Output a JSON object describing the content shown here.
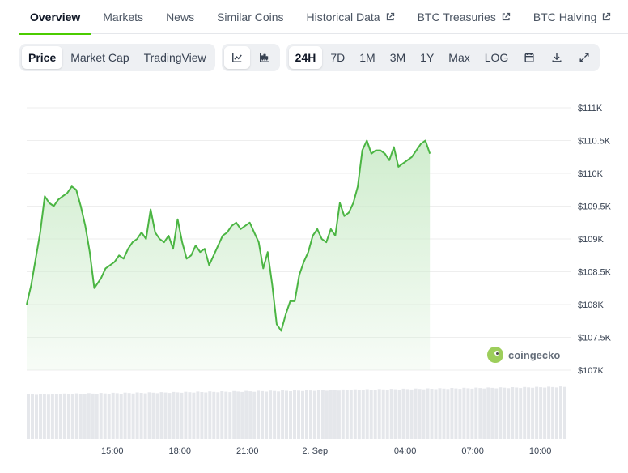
{
  "tabs": [
    {
      "label": "Overview",
      "active": true,
      "external": false
    },
    {
      "label": "Markets",
      "active": false,
      "external": false
    },
    {
      "label": "News",
      "active": false,
      "external": false
    },
    {
      "label": "Similar Coins",
      "active": false,
      "external": false
    },
    {
      "label": "Historical Data",
      "active": false,
      "external": true
    },
    {
      "label": "BTC Treasuries",
      "active": false,
      "external": true
    },
    {
      "label": "BTC Halving",
      "active": false,
      "external": true
    }
  ],
  "toolbar": {
    "chart_types": [
      "Price",
      "Market Cap",
      "TradingView"
    ],
    "active_chart_type": "Price",
    "view_icons": [
      "line-chart-icon",
      "candlestick-icon"
    ],
    "ranges": [
      "24H",
      "7D",
      "1M",
      "3M",
      "1Y",
      "Max",
      "LOG"
    ],
    "active_range": "24H",
    "action_icons": [
      "calendar-icon",
      "download-icon",
      "expand-icon"
    ]
  },
  "watermark": {
    "label": "coingecko"
  },
  "colors": {
    "line": "#4bb543",
    "fill_top": "#cdeccb",
    "grid": "#eeeeee",
    "accent": "#4bcc00",
    "volume": "#e5e7eb"
  },
  "chart_data": {
    "type": "area",
    "y_ticks": [
      "$111K",
      "$110.5K",
      "$110K",
      "$109.5K",
      "$109K",
      "$108.5K",
      "$108K",
      "$107.5K",
      "$107K"
    ],
    "ylim": [
      107000,
      111000
    ],
    "x_ticks": [
      "15:00",
      "18:00",
      "21:00",
      "2. Sep",
      "04:00",
      "07:00",
      "10:00"
    ],
    "x_tick_hours": [
      3.8,
      6.8,
      9.8,
      12.8,
      16.8,
      19.8,
      22.8
    ],
    "grid": true,
    "series": [
      {
        "x_hours": [
          0,
          0.2,
          0.4,
          0.6,
          0.8,
          1.0,
          1.2,
          1.4,
          1.6,
          1.8,
          2.0,
          2.2,
          2.4,
          2.6,
          2.8,
          3.0,
          3.3,
          3.5,
          3.7,
          3.9,
          4.1,
          4.3,
          4.5,
          4.7,
          4.9,
          5.1,
          5.3,
          5.5,
          5.7,
          5.9,
          6.1,
          6.3,
          6.5,
          6.7,
          6.9,
          7.1,
          7.3,
          7.5,
          7.7,
          7.9,
          8.1,
          8.3,
          8.5,
          8.7,
          8.9,
          9.1,
          9.3,
          9.5,
          9.7,
          9.9,
          10.1,
          10.3,
          10.5,
          10.7,
          10.9,
          11.1,
          11.3,
          11.5,
          11.7,
          11.9,
          12.1,
          12.3,
          12.5,
          12.7,
          12.9,
          13.1,
          13.3,
          13.5,
          13.7,
          13.9,
          14.1,
          14.3,
          14.5,
          14.7,
          14.9,
          15.1,
          15.3,
          15.5,
          15.7,
          15.9,
          16.1,
          16.3,
          16.5,
          16.7,
          16.9,
          17.1,
          17.3,
          17.5,
          17.7,
          17.9,
          18.1,
          18.3,
          18.5,
          18.7,
          18.9,
          19.1,
          19.3,
          19.5,
          19.7,
          19.9,
          20.1,
          20.3,
          20.5,
          20.7,
          20.9,
          21.1,
          21.3,
          21.5,
          21.7,
          21.9,
          22.1,
          22.3,
          22.5,
          22.7,
          22.9,
          23.1,
          23.3,
          23.5,
          23.7,
          23.9
        ],
        "y_values": [
          108000,
          108300,
          108700,
          109100,
          109650,
          109550,
          109500,
          109600,
          109650,
          109700,
          109800,
          109750,
          109500,
          109200,
          108800,
          108250,
          108400,
          108550,
          108600,
          108650,
          108750,
          108700,
          108850,
          108950,
          109000,
          109100,
          109000,
          109450,
          109100,
          109000,
          108950,
          109050,
          108850,
          109300,
          108950,
          108700,
          108750,
          108900,
          108800,
          108850,
          108600,
          108750,
          108900,
          109050,
          109100,
          109200,
          109250,
          109150,
          109200,
          109250,
          109100,
          108950,
          108550,
          108800,
          108300,
          107700,
          107600,
          107850,
          108050,
          108050,
          108450,
          108650,
          108800,
          109050,
          109150,
          109000,
          108950,
          109150,
          109050,
          109550,
          109350,
          109400,
          109550,
          109800,
          110350,
          110500,
          110300,
          110350,
          110350,
          110300,
          110200,
          110400,
          110100,
          110150,
          110200,
          110250,
          110350,
          110450,
          110500,
          110300
        ]
      }
    ],
    "x_range_hours": [
      0,
      24
    ]
  }
}
